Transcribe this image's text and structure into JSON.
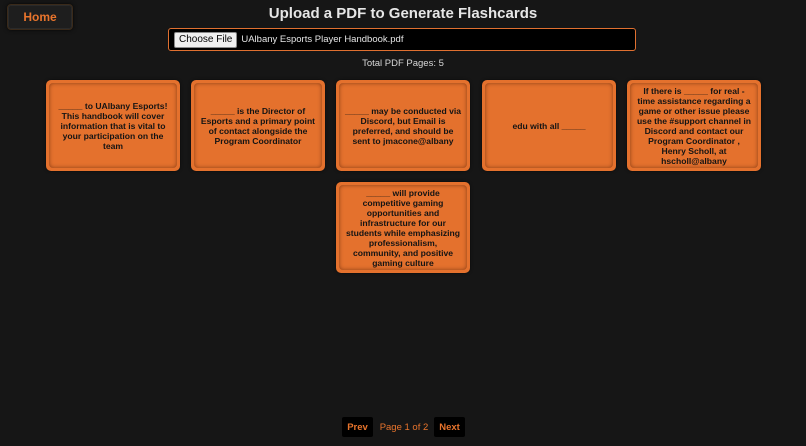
{
  "nav": {
    "home_label": "Home"
  },
  "header": {
    "title": "Upload a PDF to Generate Flashcards"
  },
  "upload": {
    "choose_label": "Choose File",
    "file_name": "UAlbany Esports Player Handbook.pdf"
  },
  "summary": {
    "total_pages_text": "Total PDF Pages: 5"
  },
  "cards": [
    {
      "text": "_____ to UAlbany Esports! This handbook will cover information that is vital to your participation on the team"
    },
    {
      "text": "_____ is the Director of Esports and a primary point of contact alongside the Program Coordinator"
    },
    {
      "text": "_____ may be conducted via Discord, but Email is preferred, and should be sent to jmacone@albany"
    },
    {
      "text": "edu with all _____"
    },
    {
      "text": "If there is _____ for real - time assistance regarding a game or other issue please use the #support channel in Discord and contact our Program Coordinator , Henry Scholl, at hscholl@albany"
    },
    {
      "text": "_____ will provide competitive gaming opportunities and infrastructure for our students while emphasizing professionalism, community, and positive gaming culture"
    }
  ],
  "pagination": {
    "prev_label": "Prev",
    "page_text": "Page 1 of 2",
    "next_label": "Next"
  },
  "colors": {
    "accent": "#e4712d",
    "background": "#161616"
  }
}
